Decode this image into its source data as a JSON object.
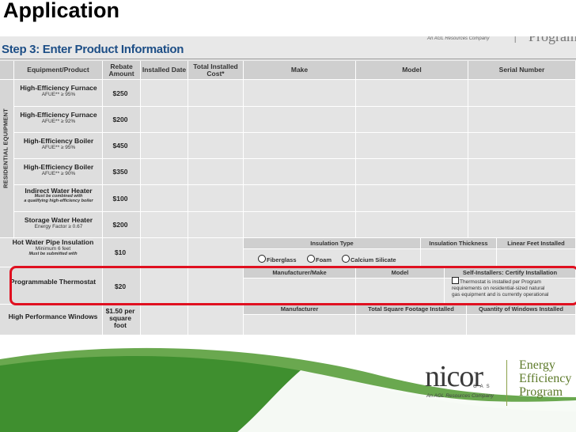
{
  "slide": {
    "title": "Application"
  },
  "form": {
    "step_title": "Step 3: Enter Product Information",
    "company_tag": "An AGL Resources Company",
    "divider": "|",
    "program_word_partial": "Program",
    "side_label": "RESIDENTIAL EQUIPMENT",
    "headers": {
      "equipment": "Equipment/Product",
      "rebate": "Rebate Amount",
      "installed_date": "Installed Date",
      "total_cost": "Total Installed Cost*",
      "make": "Make",
      "model": "Model",
      "serial": "Serial Number"
    },
    "rows": [
      {
        "name": "High-Efficiency Furnace",
        "sub": "AFUE** ≥ 95%",
        "amount": "$250"
      },
      {
        "name": "High-Efficiency Furnace",
        "sub": "AFUE** ≥ 92%",
        "amount": "$200"
      },
      {
        "name": "High-Efficiency Boiler",
        "sub": "AFUE** ≥ 95%",
        "amount": "$450"
      },
      {
        "name": "High-Efficiency Boiler",
        "sub": "AFUE** ≥ 90%",
        "amount": "$350"
      },
      {
        "name": "Indirect Water Heater",
        "sub": "Must be combined with",
        "sub2": "a qualifying high-efficiency boiler",
        "amount": "$100"
      },
      {
        "name": "Storage Water Heater",
        "sub": "Energy Factor ≥ 0.67",
        "amount": "$200"
      }
    ],
    "pipe": {
      "name": "Hot Water Pipe Insulation",
      "sub": "Minimum 6 feet",
      "sub2": "Must be submitted with",
      "amount": "$10",
      "col_type": "Insulation Type",
      "col_thickness": "Insulation Thickness",
      "col_linear": "Linear Feet Installed",
      "opt1": "Fiberglass",
      "opt2": "Foam",
      "opt3": "Calcium Silicate"
    },
    "thermostat": {
      "name": "Programmable Thermostat",
      "amount": "$20",
      "col_make": "Manufacturer/Make",
      "col_model": "Model",
      "col_cert": "Self-Installers: Certify Installation",
      "cert_line1": "Thermostat is installed per Program",
      "cert_line2": "requirements on residential-sized natural",
      "cert_line3": "gas equipment and is currently operational"
    },
    "windows": {
      "name": "High Performance Windows",
      "amount": "$1.50 per square foot",
      "col_mfr": "Manufacturer",
      "col_sqft": "Total Square Footage Installed",
      "col_qty": "Quantity of Windows Installed"
    }
  },
  "footer": {
    "logo": "nicor",
    "logo_gas": "GAS",
    "logo_tag": "An AGL Resources Company",
    "program_line1": "Energy",
    "program_line2": "Efficiency",
    "program_line3": "Program"
  },
  "colors": {
    "highlight": "#e01020",
    "brand_green": "#5d7a2a",
    "swoosh_green": "#6aa84f",
    "step_blue": "#1d4e86"
  }
}
